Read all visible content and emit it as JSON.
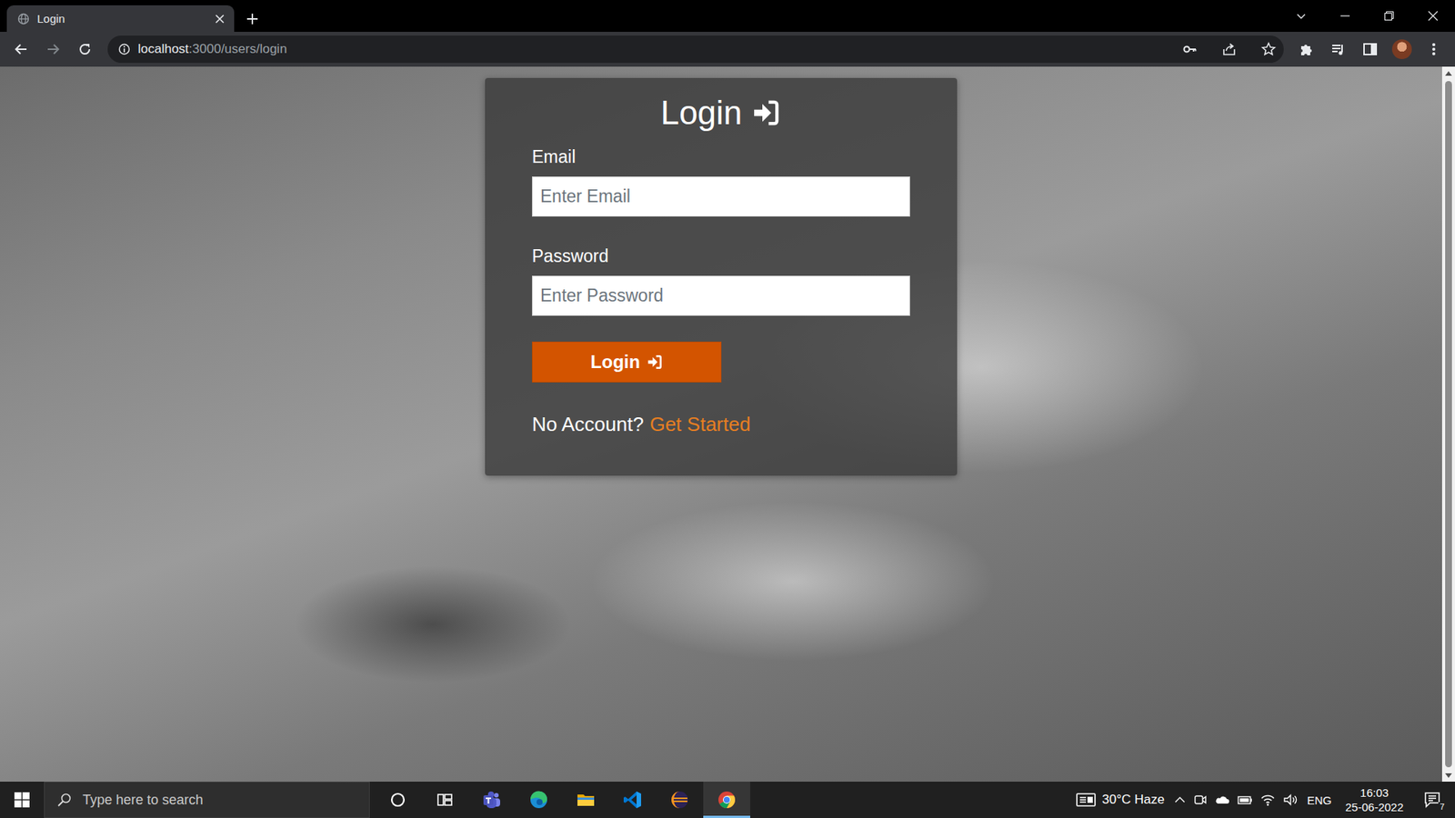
{
  "browser": {
    "tab": {
      "title": "Login"
    },
    "address": {
      "host": "localhost",
      "path": ":3000/users/login"
    }
  },
  "page": {
    "title": "Login",
    "fields": [
      {
        "label": "Email",
        "placeholder": "Enter Email"
      },
      {
        "label": "Password",
        "placeholder": "Enter Password"
      }
    ],
    "button": "Login",
    "footer": {
      "text": "No Account?",
      "link": "Get Started"
    }
  },
  "taskbar": {
    "search": {
      "placeholder": "Type here to search"
    },
    "apps": [
      {
        "kind": "cortana",
        "selected": false
      },
      {
        "kind": "taskview",
        "selected": false
      },
      {
        "kind": "teams",
        "selected": false
      },
      {
        "kind": "edge",
        "selected": false
      },
      {
        "kind": "explorer",
        "selected": false
      },
      {
        "kind": "vscode",
        "selected": false
      },
      {
        "kind": "eclipse",
        "selected": false
      },
      {
        "kind": "chrome",
        "selected": true
      }
    ],
    "weather": "30°C Haze",
    "language": "ENG",
    "time": "16:03",
    "date": "25-06-2022",
    "notifications": "7"
  }
}
